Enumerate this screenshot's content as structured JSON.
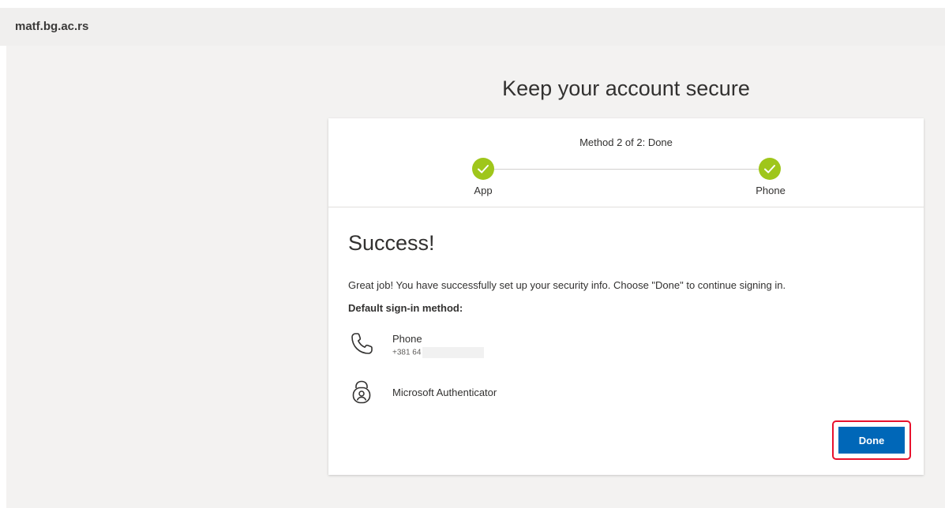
{
  "header": {
    "org_name": "matf.bg.ac.rs"
  },
  "page": {
    "title": "Keep your account secure"
  },
  "progress": {
    "status": "Method 2 of 2: Done",
    "steps": [
      {
        "label": "App",
        "state": "complete"
      },
      {
        "label": "Phone",
        "state": "complete"
      }
    ]
  },
  "content": {
    "title": "Success!",
    "message": "Great job! You have successfully set up your security info. Choose \"Done\" to continue signing in.",
    "default_label": "Default sign-in method:",
    "methods": [
      {
        "name": "Phone",
        "detail": "+381 64",
        "icon": "phone-icon"
      },
      {
        "name": "Microsoft Authenticator",
        "icon": "authenticator-lock-icon"
      }
    ]
  },
  "actions": {
    "done_label": "Done"
  },
  "colors": {
    "accent": "#0067b8",
    "success": "#9fc61b",
    "highlight": "#e8112d",
    "header_bg": "#f0efee",
    "page_bg": "#f3f2f1"
  }
}
